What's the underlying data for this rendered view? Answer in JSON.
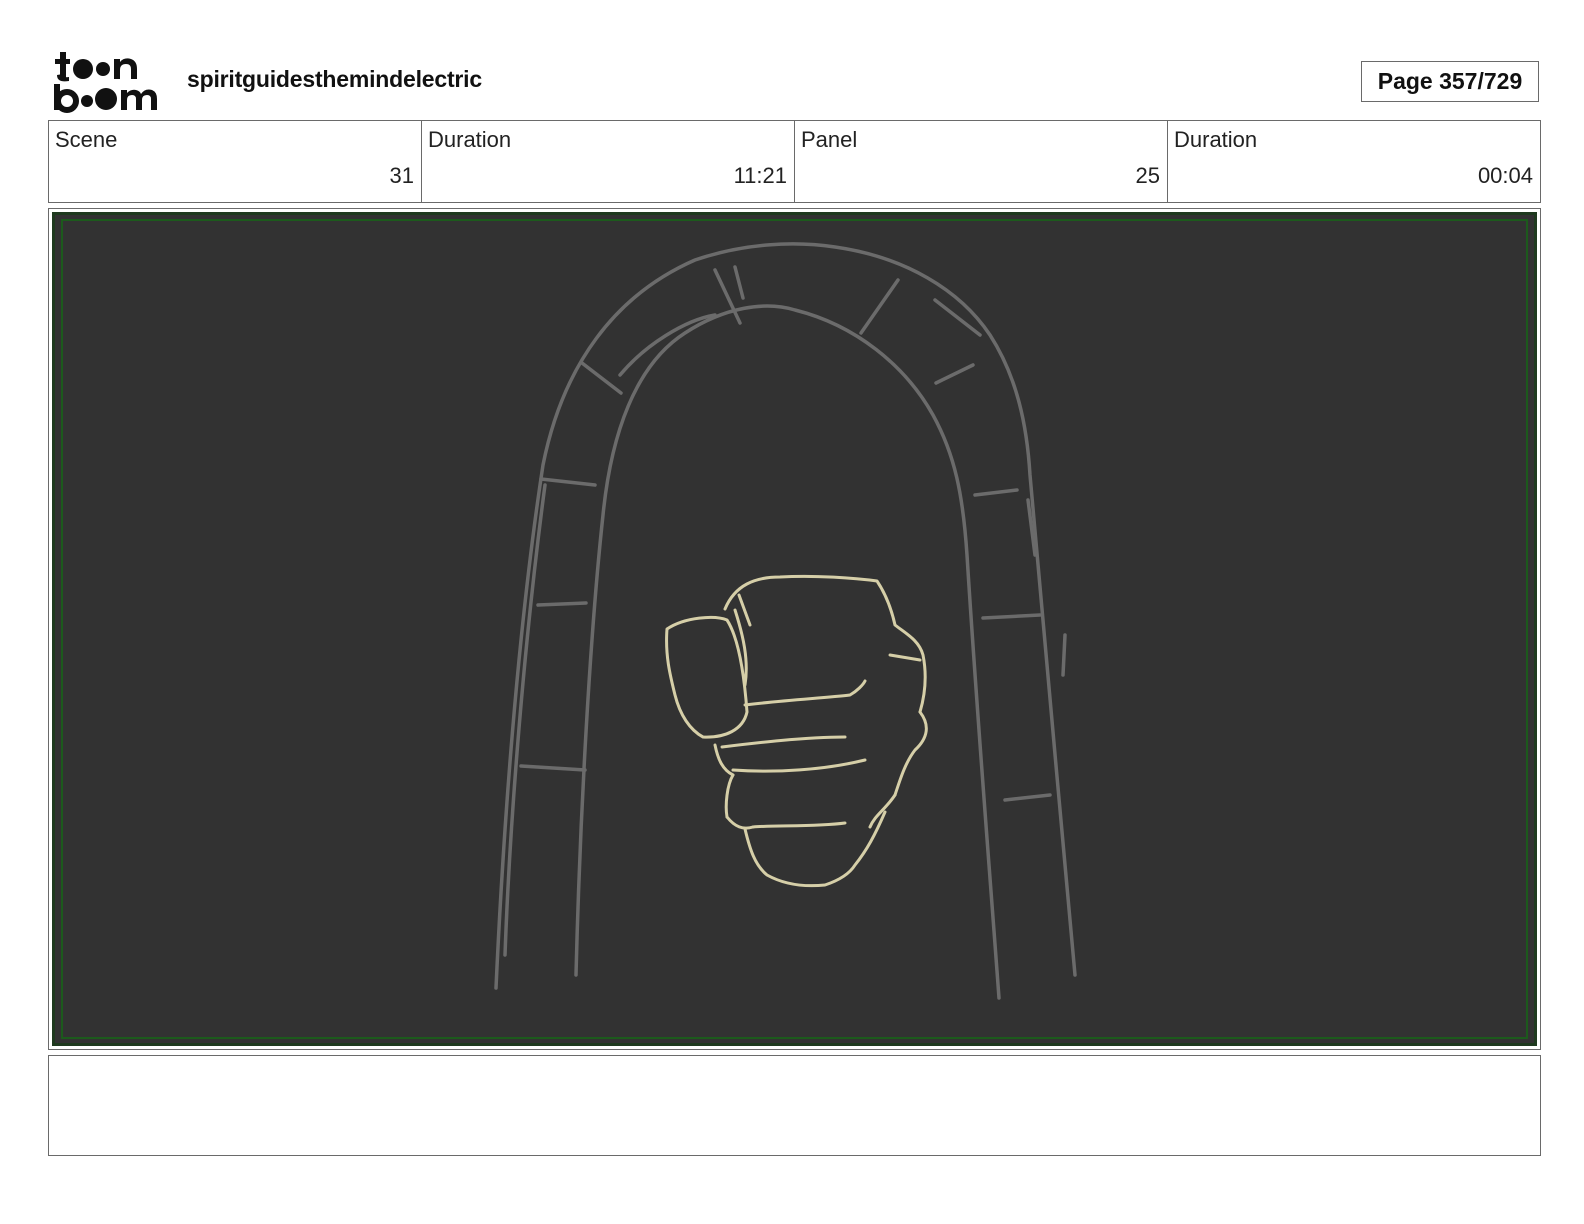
{
  "header": {
    "logo_top": "toon",
    "logo_bottom": "boom",
    "project_title": "spiritguidesthemindelectric",
    "page_label": "Page 357/729"
  },
  "info": [
    {
      "label": "Scene",
      "value": "31"
    },
    {
      "label": "Duration",
      "value": "11:21"
    },
    {
      "label": "Panel",
      "value": "25"
    },
    {
      "label": "Duration",
      "value": "00:04"
    }
  ],
  "panel": {
    "background_color": "#323232",
    "sketch_color": "#6b6b6b",
    "fist_color": "#d6cfa8",
    "safe_frame_color": "#1c5a1c"
  },
  "notes": {
    "text": ""
  }
}
